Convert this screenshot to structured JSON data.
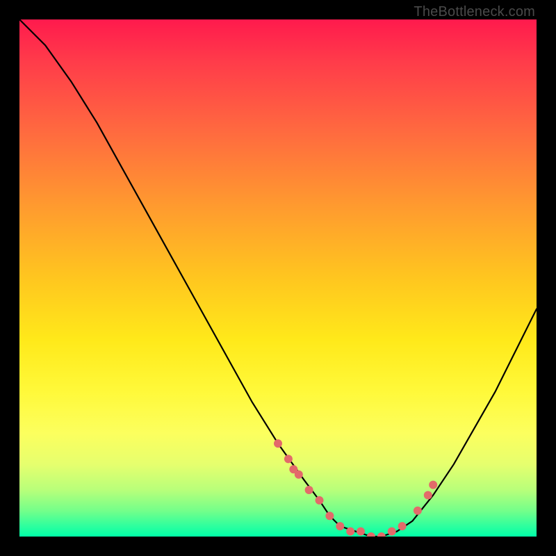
{
  "watermark": "TheBottleneck.com",
  "chart_data": {
    "type": "line",
    "title": "",
    "xlabel": "",
    "ylabel": "",
    "xlim": [
      0,
      100
    ],
    "ylim": [
      0,
      100
    ],
    "series": [
      {
        "name": "bottleneck-curve",
        "x": [
          0,
          5,
          10,
          15,
          20,
          25,
          30,
          35,
          40,
          45,
          50,
          55,
          58,
          60,
          62,
          65,
          68,
          70,
          73,
          76,
          80,
          84,
          88,
          92,
          96,
          100
        ],
        "y": [
          100,
          95,
          88,
          80,
          71,
          62,
          53,
          44,
          35,
          26,
          18,
          11,
          7,
          4,
          2,
          1,
          0,
          0,
          1,
          3,
          8,
          14,
          21,
          28,
          36,
          44
        ]
      }
    ],
    "markers": {
      "name": "highlight-dots",
      "x": [
        50,
        52,
        53,
        54,
        56,
        58,
        60,
        62,
        64,
        66,
        68,
        70,
        72,
        74,
        77,
        79,
        80
      ],
      "y": [
        18,
        15,
        13,
        12,
        9,
        7,
        4,
        2,
        1,
        1,
        0,
        0,
        1,
        2,
        5,
        8,
        10
      ]
    },
    "gradient_stops": [
      {
        "pos": 0,
        "color": "#ff1a4d"
      },
      {
        "pos": 50,
        "color": "#ffc61f"
      },
      {
        "pos": 80,
        "color": "#fcff5e"
      },
      {
        "pos": 100,
        "color": "#00ffa8"
      }
    ]
  }
}
